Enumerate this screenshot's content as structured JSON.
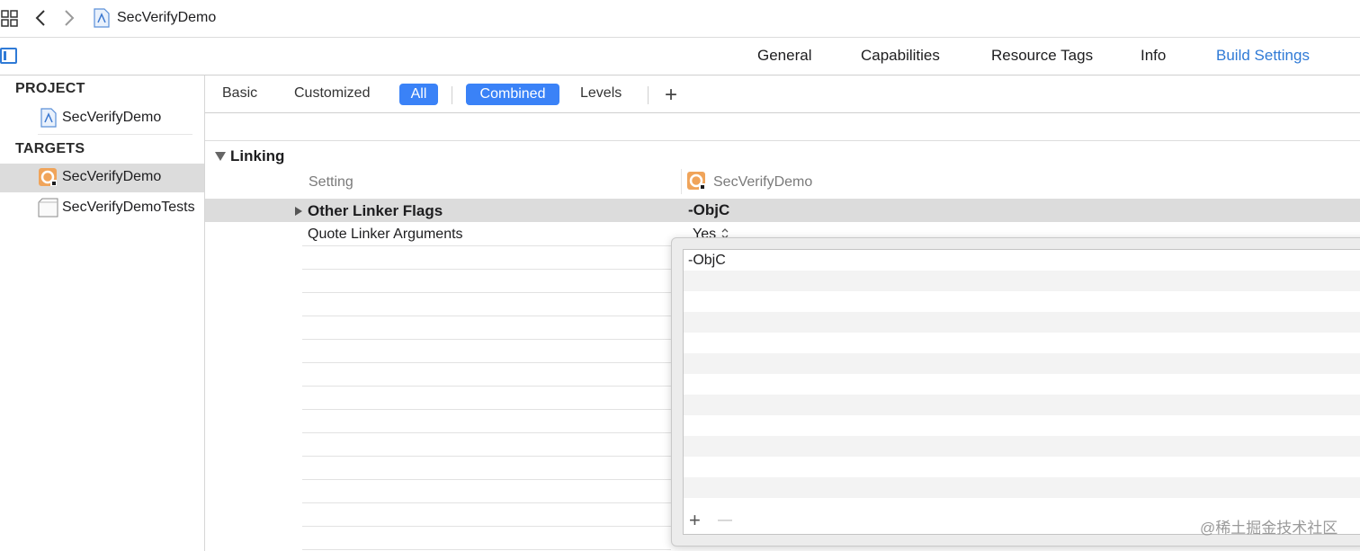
{
  "jumpbar": {
    "title": "SecVerifyDemo",
    "icons": [
      "grid-icon",
      "back-chevron-icon",
      "forward-chevron-icon",
      "project-file-icon"
    ]
  },
  "editor_tabs": [
    "General",
    "Capabilities",
    "Resource Tags",
    "Info",
    "Build Settings"
  ],
  "active_editor_tab": "Build Settings",
  "sidebar": {
    "project_header": "PROJECT",
    "project_item": "SecVerifyDemo",
    "targets_header": "TARGETS",
    "targets": [
      "SecVerifyDemo",
      "SecVerifyDemoTests"
    ],
    "selected_target": "SecVerifyDemo"
  },
  "filters": {
    "basic": "Basic",
    "customized": "Customized",
    "all": "All",
    "combined": "Combined",
    "levels": "Levels",
    "add": "+"
  },
  "settings": {
    "section": "Linking",
    "column_setting": "Setting",
    "column_target": "SecVerifyDemo",
    "rows": [
      {
        "name": "Other Linker Flags",
        "value": "-ObjC"
      },
      {
        "name": "Quote Linker Arguments",
        "value": "Yes"
      }
    ]
  },
  "popup": {
    "entries": [
      "-ObjC"
    ],
    "add_button": "+",
    "remove_button": "—"
  },
  "watermark": "@稀土掘金技术社区",
  "colors": {
    "accent": "#3a82f7",
    "active_tab": "#2f7ad6",
    "selection_row": "#dcdcdc"
  }
}
